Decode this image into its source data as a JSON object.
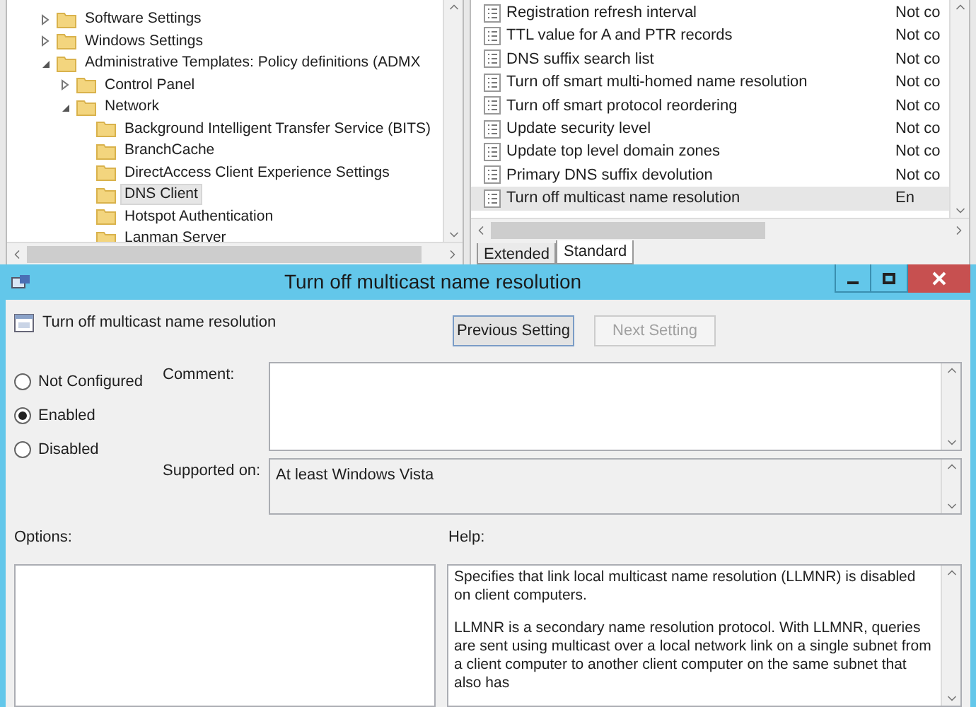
{
  "tree": [
    {
      "label": "Software Settings",
      "expanded": false,
      "selected": false
    },
    {
      "label": "Windows Settings",
      "expanded": false,
      "selected": false
    },
    {
      "label": "Administrative Templates: Policy definitions (ADMX",
      "expanded": true,
      "selected": false,
      "children": [
        {
          "label": "Control Panel",
          "expanded": false,
          "selected": false
        },
        {
          "label": "Network",
          "expanded": true,
          "selected": false,
          "children": [
            {
              "label": "Background Intelligent Transfer Service (BITS)",
              "selected": false
            },
            {
              "label": "BranchCache",
              "selected": false
            },
            {
              "label": "DirectAccess Client Experience Settings",
              "selected": false
            },
            {
              "label": "DNS Client",
              "selected": true
            },
            {
              "label": "Hotspot Authentication",
              "selected": false
            },
            {
              "label": "Lanman Server",
              "selected": false
            }
          ]
        }
      ]
    }
  ],
  "policies": [
    {
      "name": "Registration refresh interval",
      "state": "Not co",
      "selected": false
    },
    {
      "name": "TTL value for A and PTR records",
      "state": "Not co",
      "selected": false
    },
    {
      "name": "DNS suffix search list",
      "state": "Not co",
      "selected": false
    },
    {
      "name": "Turn off smart multi-homed name resolution",
      "state": "Not co",
      "selected": false
    },
    {
      "name": "Turn off smart protocol reordering",
      "state": "Not co",
      "selected": false
    },
    {
      "name": "Update security level",
      "state": "Not co",
      "selected": false
    },
    {
      "name": "Update top level domain zones",
      "state": "Not co",
      "selected": false
    },
    {
      "name": "Primary DNS suffix devolution",
      "state": "Not co",
      "selected": false
    },
    {
      "name": "Turn off multicast name resolution",
      "state": "En",
      "selected": true
    }
  ],
  "view_tabs": [
    {
      "label": "Extended",
      "selected": false
    },
    {
      "label": "Standard",
      "selected": true
    }
  ],
  "dialog": {
    "title": "Turn off multicast name resolution",
    "setting_name": "Turn off multicast name resolution",
    "nav_buttons": [
      {
        "label": "Previous Setting",
        "disabled": false
      },
      {
        "label": "Next Setting",
        "disabled": true
      }
    ],
    "options": [
      {
        "label": "Not Configured",
        "selected": false
      },
      {
        "label": "Enabled",
        "selected": true
      },
      {
        "label": "Disabled",
        "selected": false
      }
    ],
    "comment_label": "Comment:",
    "supported_label": "Supported on:",
    "supported_value": "At least Windows Vista",
    "options_label": "Options:",
    "help_label": "Help:",
    "help_paragraphs": [
      "Specifies that link local multicast name resolution (LLMNR) is disabled on client computers.",
      "LLMNR is a secondary name resolution protocol. With LLMNR, queries are sent using multicast over a local network link on a single subnet from a client computer to another client computer on the same subnet that also has"
    ]
  }
}
